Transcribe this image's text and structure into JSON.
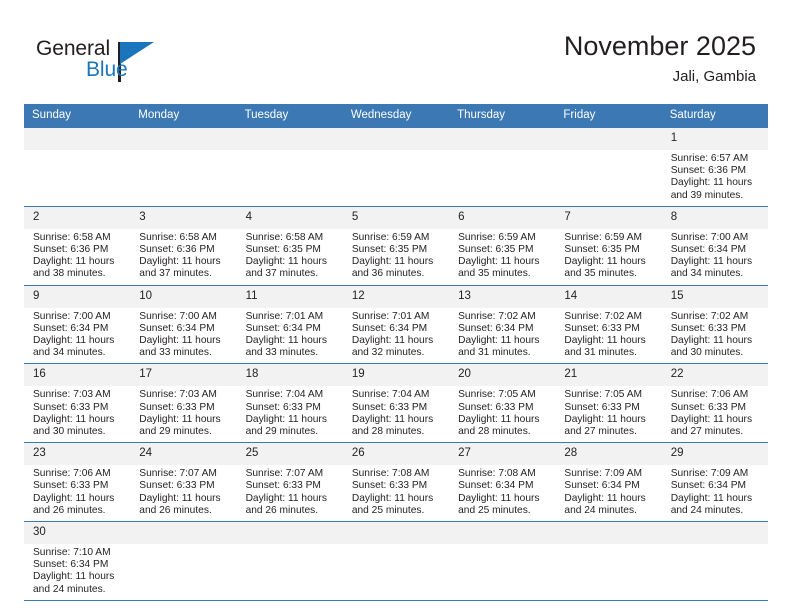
{
  "brand": {
    "name_part1": "General",
    "name_part2": "Blue",
    "logo_icon": "triangle-flag-icon"
  },
  "header": {
    "title": "November 2025",
    "subtitle": "Jali, Gambia"
  },
  "calendar": {
    "weekday_headers": [
      "Sunday",
      "Monday",
      "Tuesday",
      "Wednesday",
      "Thursday",
      "Friday",
      "Saturday"
    ],
    "header_bg": "#3b78b4",
    "daynum_bg": "#f2f2f2",
    "row_border": "#3b78b4",
    "weeks": [
      [
        {
          "day": "",
          "blank": true,
          "sunrise": "",
          "sunset": "",
          "daylight1": "",
          "daylight2": ""
        },
        {
          "day": "",
          "blank": true,
          "sunrise": "",
          "sunset": "",
          "daylight1": "",
          "daylight2": ""
        },
        {
          "day": "",
          "blank": true,
          "sunrise": "",
          "sunset": "",
          "daylight1": "",
          "daylight2": ""
        },
        {
          "day": "",
          "blank": true,
          "sunrise": "",
          "sunset": "",
          "daylight1": "",
          "daylight2": ""
        },
        {
          "day": "",
          "blank": true,
          "sunrise": "",
          "sunset": "",
          "daylight1": "",
          "daylight2": ""
        },
        {
          "day": "",
          "blank": true,
          "sunrise": "",
          "sunset": "",
          "daylight1": "",
          "daylight2": ""
        },
        {
          "day": "1",
          "blank": false,
          "sunrise": "Sunrise: 6:57 AM",
          "sunset": "Sunset: 6:36 PM",
          "daylight1": "Daylight: 11 hours",
          "daylight2": "and 39 minutes."
        }
      ],
      [
        {
          "day": "2",
          "blank": false,
          "sunrise": "Sunrise: 6:58 AM",
          "sunset": "Sunset: 6:36 PM",
          "daylight1": "Daylight: 11 hours",
          "daylight2": "and 38 minutes."
        },
        {
          "day": "3",
          "blank": false,
          "sunrise": "Sunrise: 6:58 AM",
          "sunset": "Sunset: 6:36 PM",
          "daylight1": "Daylight: 11 hours",
          "daylight2": "and 37 minutes."
        },
        {
          "day": "4",
          "blank": false,
          "sunrise": "Sunrise: 6:58 AM",
          "sunset": "Sunset: 6:35 PM",
          "daylight1": "Daylight: 11 hours",
          "daylight2": "and 37 minutes."
        },
        {
          "day": "5",
          "blank": false,
          "sunrise": "Sunrise: 6:59 AM",
          "sunset": "Sunset: 6:35 PM",
          "daylight1": "Daylight: 11 hours",
          "daylight2": "and 36 minutes."
        },
        {
          "day": "6",
          "blank": false,
          "sunrise": "Sunrise: 6:59 AM",
          "sunset": "Sunset: 6:35 PM",
          "daylight1": "Daylight: 11 hours",
          "daylight2": "and 35 minutes."
        },
        {
          "day": "7",
          "blank": false,
          "sunrise": "Sunrise: 6:59 AM",
          "sunset": "Sunset: 6:35 PM",
          "daylight1": "Daylight: 11 hours",
          "daylight2": "and 35 minutes."
        },
        {
          "day": "8",
          "blank": false,
          "sunrise": "Sunrise: 7:00 AM",
          "sunset": "Sunset: 6:34 PM",
          "daylight1": "Daylight: 11 hours",
          "daylight2": "and 34 minutes."
        }
      ],
      [
        {
          "day": "9",
          "blank": false,
          "sunrise": "Sunrise: 7:00 AM",
          "sunset": "Sunset: 6:34 PM",
          "daylight1": "Daylight: 11 hours",
          "daylight2": "and 34 minutes."
        },
        {
          "day": "10",
          "blank": false,
          "sunrise": "Sunrise: 7:00 AM",
          "sunset": "Sunset: 6:34 PM",
          "daylight1": "Daylight: 11 hours",
          "daylight2": "and 33 minutes."
        },
        {
          "day": "11",
          "blank": false,
          "sunrise": "Sunrise: 7:01 AM",
          "sunset": "Sunset: 6:34 PM",
          "daylight1": "Daylight: 11 hours",
          "daylight2": "and 33 minutes."
        },
        {
          "day": "12",
          "blank": false,
          "sunrise": "Sunrise: 7:01 AM",
          "sunset": "Sunset: 6:34 PM",
          "daylight1": "Daylight: 11 hours",
          "daylight2": "and 32 minutes."
        },
        {
          "day": "13",
          "blank": false,
          "sunrise": "Sunrise: 7:02 AM",
          "sunset": "Sunset: 6:34 PM",
          "daylight1": "Daylight: 11 hours",
          "daylight2": "and 31 minutes."
        },
        {
          "day": "14",
          "blank": false,
          "sunrise": "Sunrise: 7:02 AM",
          "sunset": "Sunset: 6:33 PM",
          "daylight1": "Daylight: 11 hours",
          "daylight2": "and 31 minutes."
        },
        {
          "day": "15",
          "blank": false,
          "sunrise": "Sunrise: 7:02 AM",
          "sunset": "Sunset: 6:33 PM",
          "daylight1": "Daylight: 11 hours",
          "daylight2": "and 30 minutes."
        }
      ],
      [
        {
          "day": "16",
          "blank": false,
          "sunrise": "Sunrise: 7:03 AM",
          "sunset": "Sunset: 6:33 PM",
          "daylight1": "Daylight: 11 hours",
          "daylight2": "and 30 minutes."
        },
        {
          "day": "17",
          "blank": false,
          "sunrise": "Sunrise: 7:03 AM",
          "sunset": "Sunset: 6:33 PM",
          "daylight1": "Daylight: 11 hours",
          "daylight2": "and 29 minutes."
        },
        {
          "day": "18",
          "blank": false,
          "sunrise": "Sunrise: 7:04 AM",
          "sunset": "Sunset: 6:33 PM",
          "daylight1": "Daylight: 11 hours",
          "daylight2": "and 29 minutes."
        },
        {
          "day": "19",
          "blank": false,
          "sunrise": "Sunrise: 7:04 AM",
          "sunset": "Sunset: 6:33 PM",
          "daylight1": "Daylight: 11 hours",
          "daylight2": "and 28 minutes."
        },
        {
          "day": "20",
          "blank": false,
          "sunrise": "Sunrise: 7:05 AM",
          "sunset": "Sunset: 6:33 PM",
          "daylight1": "Daylight: 11 hours",
          "daylight2": "and 28 minutes."
        },
        {
          "day": "21",
          "blank": false,
          "sunrise": "Sunrise: 7:05 AM",
          "sunset": "Sunset: 6:33 PM",
          "daylight1": "Daylight: 11 hours",
          "daylight2": "and 27 minutes."
        },
        {
          "day": "22",
          "blank": false,
          "sunrise": "Sunrise: 7:06 AM",
          "sunset": "Sunset: 6:33 PM",
          "daylight1": "Daylight: 11 hours",
          "daylight2": "and 27 minutes."
        }
      ],
      [
        {
          "day": "23",
          "blank": false,
          "sunrise": "Sunrise: 7:06 AM",
          "sunset": "Sunset: 6:33 PM",
          "daylight1": "Daylight: 11 hours",
          "daylight2": "and 26 minutes."
        },
        {
          "day": "24",
          "blank": false,
          "sunrise": "Sunrise: 7:07 AM",
          "sunset": "Sunset: 6:33 PM",
          "daylight1": "Daylight: 11 hours",
          "daylight2": "and 26 minutes."
        },
        {
          "day": "25",
          "blank": false,
          "sunrise": "Sunrise: 7:07 AM",
          "sunset": "Sunset: 6:33 PM",
          "daylight1": "Daylight: 11 hours",
          "daylight2": "and 26 minutes."
        },
        {
          "day": "26",
          "blank": false,
          "sunrise": "Sunrise: 7:08 AM",
          "sunset": "Sunset: 6:33 PM",
          "daylight1": "Daylight: 11 hours",
          "daylight2": "and 25 minutes."
        },
        {
          "day": "27",
          "blank": false,
          "sunrise": "Sunrise: 7:08 AM",
          "sunset": "Sunset: 6:34 PM",
          "daylight1": "Daylight: 11 hours",
          "daylight2": "and 25 minutes."
        },
        {
          "day": "28",
          "blank": false,
          "sunrise": "Sunrise: 7:09 AM",
          "sunset": "Sunset: 6:34 PM",
          "daylight1": "Daylight: 11 hours",
          "daylight2": "and 24 minutes."
        },
        {
          "day": "29",
          "blank": false,
          "sunrise": "Sunrise: 7:09 AM",
          "sunset": "Sunset: 6:34 PM",
          "daylight1": "Daylight: 11 hours",
          "daylight2": "and 24 minutes."
        }
      ],
      [
        {
          "day": "30",
          "blank": false,
          "sunrise": "Sunrise: 7:10 AM",
          "sunset": "Sunset: 6:34 PM",
          "daylight1": "Daylight: 11 hours",
          "daylight2": "and 24 minutes."
        },
        {
          "day": "",
          "blank": true,
          "sunrise": "",
          "sunset": "",
          "daylight1": "",
          "daylight2": ""
        },
        {
          "day": "",
          "blank": true,
          "sunrise": "",
          "sunset": "",
          "daylight1": "",
          "daylight2": ""
        },
        {
          "day": "",
          "blank": true,
          "sunrise": "",
          "sunset": "",
          "daylight1": "",
          "daylight2": ""
        },
        {
          "day": "",
          "blank": true,
          "sunrise": "",
          "sunset": "",
          "daylight1": "",
          "daylight2": ""
        },
        {
          "day": "",
          "blank": true,
          "sunrise": "",
          "sunset": "",
          "daylight1": "",
          "daylight2": ""
        },
        {
          "day": "",
          "blank": true,
          "sunrise": "",
          "sunset": "",
          "daylight1": "",
          "daylight2": ""
        }
      ]
    ]
  }
}
